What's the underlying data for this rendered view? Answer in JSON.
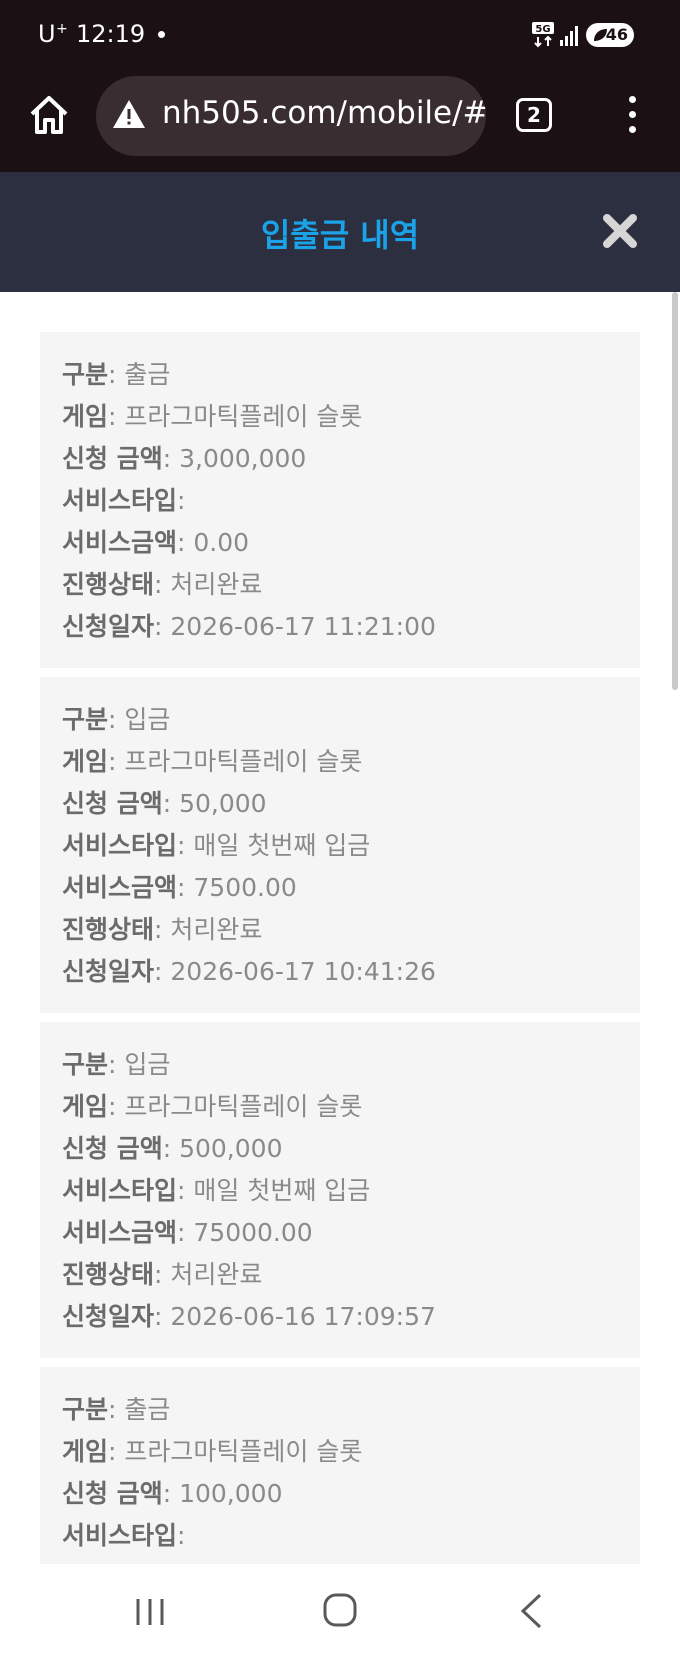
{
  "status_bar": {
    "carrier": "U",
    "carrier_sup": "+",
    "time": "12:19",
    "network": "5G",
    "battery": "46"
  },
  "browser": {
    "url": "nh505.com/mobile/#/",
    "tab_count": "2"
  },
  "modal": {
    "title": "입출금 내역"
  },
  "labels": {
    "type": "구분",
    "game": "게임",
    "amount": "신청 금액",
    "service_type": "서비스타입",
    "service_amount": "서비스금액",
    "status": "진행상태",
    "date": "신청일자"
  },
  "records": [
    {
      "type": "출금",
      "game": "프라그마틱플레이 슬롯",
      "amount": "3,000,000",
      "service_type": "",
      "service_amount": "0.00",
      "status": "처리완료",
      "date": "2026-06-17 11:21:00"
    },
    {
      "type": "입금",
      "game": "프라그마틱플레이 슬롯",
      "amount": "50,000",
      "service_type": "매일 첫번째 입금",
      "service_amount": "7500.00",
      "status": "처리완료",
      "date": "2026-06-17 10:41:26"
    },
    {
      "type": "입금",
      "game": "프라그마틱플레이 슬롯",
      "amount": "500,000",
      "service_type": "매일 첫번째 입금",
      "service_amount": "75000.00",
      "status": "처리완료",
      "date": "2026-06-16 17:09:57"
    },
    {
      "type": "출금",
      "game": "프라그마틱플레이 슬롯",
      "amount": "100,000",
      "service_type": "",
      "service_amount": "",
      "status": "",
      "date": ""
    }
  ],
  "colors": {
    "title_accent": "#1aa3e8",
    "header_bg": "#2c2f3f",
    "card_bg": "#f5f5f5"
  },
  "icons": {
    "home": "home-icon",
    "warning": "warning-icon",
    "close": "close-icon",
    "menu": "more-vertical-icon"
  }
}
